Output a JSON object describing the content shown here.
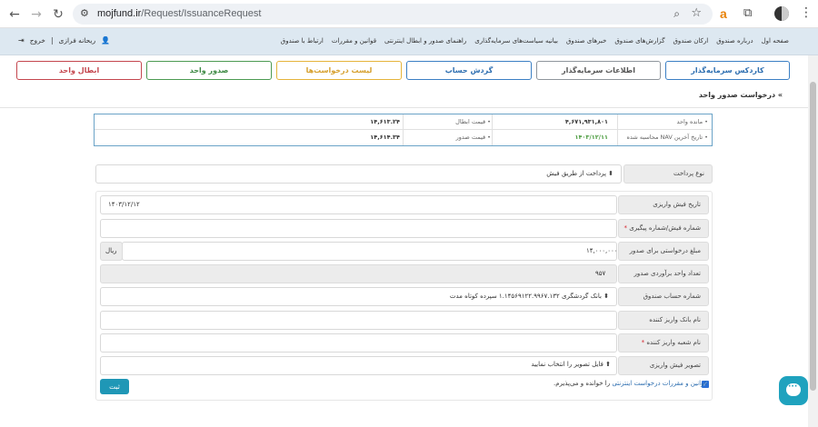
{
  "browser": {
    "url_host": "mojfund.ir",
    "url_path": "/Request/IssuanceRequest"
  },
  "header": {
    "menu": [
      "صفحه اول",
      "درباره صندوق",
      "ارکان صندوق",
      "گزارش‌های صندوق",
      "خبرهای صندوق",
      "بیانیه سیاست‌های سرمایه‌گذاری",
      "راهنمای صدور و ابطال اینترنتی",
      "قوانین و مقررات",
      "ارتباط با صندوق"
    ],
    "user_name": "ریحانه فرازی",
    "logout": "خروج"
  },
  "tabs": [
    {
      "label": "کاردکس سرمایه‌گذار",
      "style": "blue"
    },
    {
      "label": "اطلاعات سرمایه‌گذار",
      "style": "gray"
    },
    {
      "label": "گردش حساب",
      "style": "blue"
    },
    {
      "label": "لیست درخواست‌ها",
      "style": "yellow"
    },
    {
      "label": "صدور واحد",
      "style": "green"
    },
    {
      "label": "ابطال واحد",
      "style": "red"
    }
  ],
  "breadcrumb": "درخواست صدور واحد",
  "info": {
    "remaining_units_label": "مانده واحد",
    "remaining_units_value": "۴,۶۷۱,۹۳۱,۸۰۱",
    "cancel_price_label": "قیمت ابطال",
    "cancel_price_value": "۱۴,۶۱۳.۲۴",
    "nav_date_label": "تاریخ آخرین NAV محاسبه شده",
    "nav_date_value": "۱۴۰۳/۱۲/۱۱",
    "issue_price_label": "قیمت صدور",
    "issue_price_value": "۱۴,۶۱۴.۳۴",
    "bullet": "•"
  },
  "form": {
    "payment_type_label": "نوع پرداخت",
    "payment_type_value": "پرداخت از طریق فیش",
    "receipt_date_label": "تاریخ فیش واریزی",
    "receipt_date_value": "۱۴۰۳/۱۲/۱۲",
    "tracking_label": "شماره فیش/شماره پیگیری",
    "amount_label": "مبلغ درخواستی برای صدور",
    "amount_value": "۱۴,۰۰۰,۰۰۰",
    "currency": "ریال",
    "units_label": "تعداد واحد برآوردی صدور",
    "units_value": "۹۵۷",
    "account_label": "شماره حساب صندوق",
    "account_value": "بانک گردشگری ۱.۱۴۵۶۹۱۲۲.۹۹۶۷.۱۳۲ سپرده کوتاه مدت",
    "depositor_bank_label": "نام بانک واریز کننده",
    "depositor_branch_label": "نام شعبه واریز کننده",
    "receipt_image_label": "تصویر فیش واریزی",
    "upload_text": "فایل تصویر را انتخاب نمایید",
    "required_mark": "*",
    "terms_link": "قوانین و مقررات درخواست اینترنتی",
    "terms_suffix": "را خوانده و می‌پذیرم.",
    "submit": "ثبت"
  },
  "colors": {
    "header_bg": "#dde8f1",
    "accent": "#1f97b6",
    "tab_blue": "#3b7fc4",
    "tab_yellow": "#e5b43b",
    "tab_green": "#4c9a52",
    "tab_red": "#c4464e"
  }
}
